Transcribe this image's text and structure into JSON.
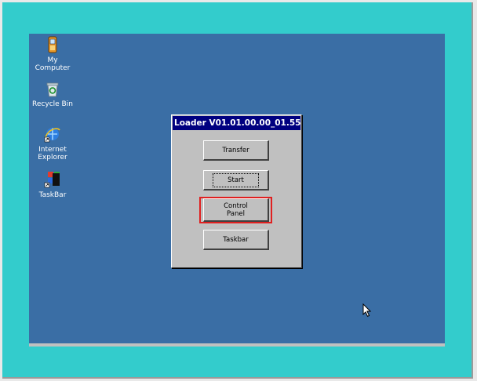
{
  "desktop": {
    "background_color": "#3a6ea5",
    "icons": [
      {
        "label": "My\nComputer",
        "icon": "my-computer-icon"
      },
      {
        "label": "Recycle Bin",
        "icon": "recycle-bin-icon"
      },
      {
        "label": "Internet\nExplorer",
        "icon": "internet-explorer-icon"
      },
      {
        "label": "TaskBar",
        "icon": "taskbar-shortcut-icon"
      }
    ]
  },
  "dialog": {
    "title": "Loader V01.01.00.00_01.55",
    "buttons": [
      {
        "label": "Transfer"
      },
      {
        "label": "Start"
      },
      {
        "label": "Control\nPanel"
      },
      {
        "label": "Taskbar"
      }
    ],
    "highlight_color": "#e02020"
  },
  "colors": {
    "frame": "#33cccc",
    "title_bar": "#000080",
    "dialog_face": "#c0c0c0"
  }
}
